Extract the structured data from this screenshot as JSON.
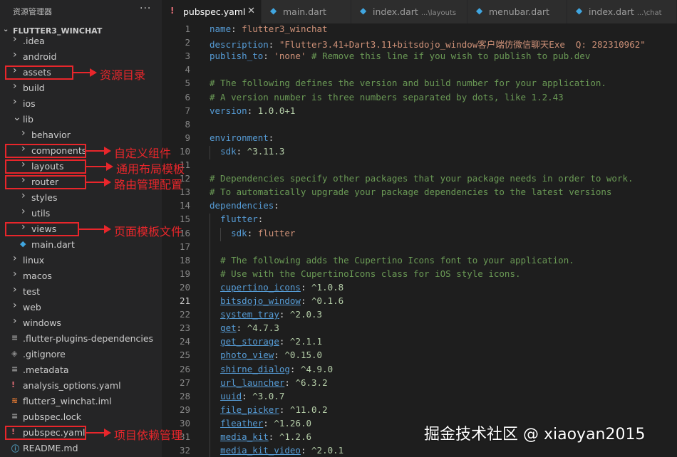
{
  "sidebar": {
    "title": "资源管理器",
    "more_icon": "···",
    "root_folder": "FLUTTER3_WINCHAT",
    "items": [
      {
        "label": ".idea",
        "type": "folder",
        "indent": 0
      },
      {
        "label": "android",
        "type": "folder",
        "indent": 0
      },
      {
        "label": "assets",
        "type": "folder",
        "indent": 0
      },
      {
        "label": "build",
        "type": "folder",
        "indent": 0
      },
      {
        "label": "ios",
        "type": "folder",
        "indent": 0
      },
      {
        "label": "lib",
        "type": "folder-open",
        "indent": 0
      },
      {
        "label": "behavior",
        "type": "folder",
        "indent": 1
      },
      {
        "label": "components",
        "type": "folder",
        "indent": 1
      },
      {
        "label": "layouts",
        "type": "folder",
        "indent": 1
      },
      {
        "label": "router",
        "type": "folder",
        "indent": 1
      },
      {
        "label": "styles",
        "type": "folder",
        "indent": 1
      },
      {
        "label": "utils",
        "type": "folder",
        "indent": 1
      },
      {
        "label": "views",
        "type": "folder",
        "indent": 1
      },
      {
        "label": "main.dart",
        "type": "dart",
        "indent": 1
      },
      {
        "label": "linux",
        "type": "folder",
        "indent": 0
      },
      {
        "label": "macos",
        "type": "folder",
        "indent": 0
      },
      {
        "label": "test",
        "type": "folder",
        "indent": 0
      },
      {
        "label": "web",
        "type": "folder",
        "indent": 0
      },
      {
        "label": "windows",
        "type": "folder",
        "indent": 0
      },
      {
        "label": ".flutter-plugins-dependencies",
        "type": "lines",
        "indent": 0
      },
      {
        "label": ".gitignore",
        "type": "git",
        "indent": 0
      },
      {
        "label": ".metadata",
        "type": "lines",
        "indent": 0
      },
      {
        "label": "analysis_options.yaml",
        "type": "yaml",
        "indent": 0
      },
      {
        "label": "flutter3_winchat.iml",
        "type": "rss",
        "indent": 0
      },
      {
        "label": "pubspec.lock",
        "type": "lines",
        "indent": 0
      },
      {
        "label": "pubspec.yaml",
        "type": "yaml",
        "indent": 0
      },
      {
        "label": "README.md",
        "type": "info",
        "indent": 0
      }
    ]
  },
  "annotations": [
    {
      "text": "资源目录",
      "target": "assets"
    },
    {
      "text": "自定义组件",
      "target": "components"
    },
    {
      "text": "通用布局模板",
      "target": "layouts"
    },
    {
      "text": "路由管理配置",
      "target": "router"
    },
    {
      "text": "页面模板文件",
      "target": "views"
    },
    {
      "text": "项目依赖管理",
      "target": "pubspec.yaml"
    }
  ],
  "tabs": [
    {
      "label": "pubspec.yaml",
      "icon": "!",
      "active": true,
      "desc": ""
    },
    {
      "label": "main.dart",
      "icon": "dart",
      "active": false,
      "desc": ""
    },
    {
      "label": "index.dart",
      "icon": "dart",
      "active": false,
      "desc": "...\\layouts"
    },
    {
      "label": "menubar.dart",
      "icon": "dart",
      "active": false,
      "desc": ""
    },
    {
      "label": "index.dart",
      "icon": "dart",
      "active": false,
      "desc": "...\\chat"
    }
  ],
  "editor": {
    "current_line": 21,
    "lines": [
      {
        "n": 1,
        "t": [
          [
            "k",
            "name"
          ],
          [
            "p",
            ": "
          ],
          [
            "s",
            "flutter3_winchat"
          ]
        ]
      },
      {
        "n": 2,
        "t": [
          [
            "k",
            "description"
          ],
          [
            "p",
            ": "
          ],
          [
            "s",
            "\"Flutter3.41+Dart3.11+bitsdojo_window客户端仿微信聊天Exe  Q: 282310962\""
          ]
        ]
      },
      {
        "n": 3,
        "t": [
          [
            "k",
            "publish_to"
          ],
          [
            "p",
            ": "
          ],
          [
            "s",
            "'none'"
          ],
          [
            "p",
            " "
          ],
          [
            "c",
            "# Remove this line if you wish to publish to pub.dev"
          ]
        ]
      },
      {
        "n": 4,
        "t": []
      },
      {
        "n": 5,
        "t": [
          [
            "c",
            "# The following defines the version and build number for your application."
          ]
        ]
      },
      {
        "n": 6,
        "t": [
          [
            "c",
            "# A version number is three numbers separated by dots, like 1.2.43"
          ]
        ]
      },
      {
        "n": 7,
        "t": [
          [
            "k",
            "version"
          ],
          [
            "p",
            ": "
          ],
          [
            "v",
            "1.0.0+1"
          ]
        ]
      },
      {
        "n": 8,
        "t": []
      },
      {
        "n": 9,
        "t": [
          [
            "k",
            "environment"
          ],
          [
            "p",
            ":"
          ]
        ]
      },
      {
        "n": 10,
        "t": [
          [
            "p",
            "  "
          ],
          [
            "k",
            "sdk"
          ],
          [
            "p",
            ": "
          ],
          [
            "v",
            "^3.11.3"
          ]
        ]
      },
      {
        "n": 11,
        "t": []
      },
      {
        "n": 12,
        "t": [
          [
            "c",
            "# Dependencies specify other packages that your package needs in order to work."
          ]
        ]
      },
      {
        "n": 13,
        "t": [
          [
            "c",
            "# To automatically upgrade your package dependencies to the latest versions"
          ]
        ]
      },
      {
        "n": 14,
        "t": [
          [
            "k",
            "dependencies"
          ],
          [
            "p",
            ":"
          ]
        ]
      },
      {
        "n": 15,
        "t": [
          [
            "p",
            "  "
          ],
          [
            "k",
            "flutter"
          ],
          [
            "p",
            ":"
          ]
        ]
      },
      {
        "n": 16,
        "t": [
          [
            "p",
            "    "
          ],
          [
            "k",
            "sdk"
          ],
          [
            "p",
            ": "
          ],
          [
            "s",
            "flutter"
          ]
        ]
      },
      {
        "n": 17,
        "t": []
      },
      {
        "n": 18,
        "t": [
          [
            "p",
            "  "
          ],
          [
            "c",
            "# The following adds the Cupertino Icons font to your application."
          ]
        ]
      },
      {
        "n": 19,
        "t": [
          [
            "p",
            "  "
          ],
          [
            "c",
            "# Use with the CupertinoIcons class for iOS style icons."
          ]
        ]
      },
      {
        "n": 20,
        "t": [
          [
            "p",
            "  "
          ],
          [
            "ku",
            "cupertino_icons"
          ],
          [
            "p",
            ": "
          ],
          [
            "v",
            "^1.0.8"
          ]
        ]
      },
      {
        "n": 21,
        "t": [
          [
            "p",
            "  "
          ],
          [
            "ku",
            "bitsdojo_window"
          ],
          [
            "p",
            ": "
          ],
          [
            "v",
            "^0.1.6"
          ]
        ]
      },
      {
        "n": 22,
        "t": [
          [
            "p",
            "  "
          ],
          [
            "ku",
            "system_tray"
          ],
          [
            "p",
            ": "
          ],
          [
            "v",
            "^2.0.3"
          ]
        ]
      },
      {
        "n": 23,
        "t": [
          [
            "p",
            "  "
          ],
          [
            "ku",
            "get"
          ],
          [
            "p",
            ": "
          ],
          [
            "v",
            "^4.7.3"
          ]
        ]
      },
      {
        "n": 24,
        "t": [
          [
            "p",
            "  "
          ],
          [
            "ku",
            "get_storage"
          ],
          [
            "p",
            ": "
          ],
          [
            "v",
            "^2.1.1"
          ]
        ]
      },
      {
        "n": 25,
        "t": [
          [
            "p",
            "  "
          ],
          [
            "ku",
            "photo_view"
          ],
          [
            "p",
            ": "
          ],
          [
            "v",
            "^0.15.0"
          ]
        ]
      },
      {
        "n": 26,
        "t": [
          [
            "p",
            "  "
          ],
          [
            "ku",
            "shirne_dialog"
          ],
          [
            "p",
            ": "
          ],
          [
            "v",
            "^4.9.0"
          ]
        ]
      },
      {
        "n": 27,
        "t": [
          [
            "p",
            "  "
          ],
          [
            "ku",
            "url_launcher"
          ],
          [
            "p",
            ": "
          ],
          [
            "v",
            "^6.3.2"
          ]
        ]
      },
      {
        "n": 28,
        "t": [
          [
            "p",
            "  "
          ],
          [
            "ku",
            "uuid"
          ],
          [
            "p",
            ": "
          ],
          [
            "v",
            "^3.0.7"
          ]
        ]
      },
      {
        "n": 29,
        "t": [
          [
            "p",
            "  "
          ],
          [
            "ku",
            "file_picker"
          ],
          [
            "p",
            ": "
          ],
          [
            "v",
            "^11.0.2"
          ]
        ]
      },
      {
        "n": 30,
        "t": [
          [
            "p",
            "  "
          ],
          [
            "ku",
            "fleather"
          ],
          [
            "p",
            ": "
          ],
          [
            "v",
            "^1.26.0"
          ]
        ]
      },
      {
        "n": 31,
        "t": [
          [
            "p",
            "  "
          ],
          [
            "ku",
            "media_kit"
          ],
          [
            "p",
            ": "
          ],
          [
            "v",
            "^1.2.6"
          ]
        ]
      },
      {
        "n": 32,
        "t": [
          [
            "p",
            "  "
          ],
          [
            "ku",
            "media_kit_video"
          ],
          [
            "p",
            ": "
          ],
          [
            "v",
            "^2.0.1"
          ]
        ]
      }
    ]
  },
  "watermark": "掘金技术社区 @ xiaoyan2015",
  "colors": {
    "highlight_red": "#e8262b",
    "yaml_icon": "#e06c75",
    "dart_icon": "#40a6e0",
    "key": "#569cd6",
    "string": "#ce9178",
    "comment": "#6a9955"
  }
}
